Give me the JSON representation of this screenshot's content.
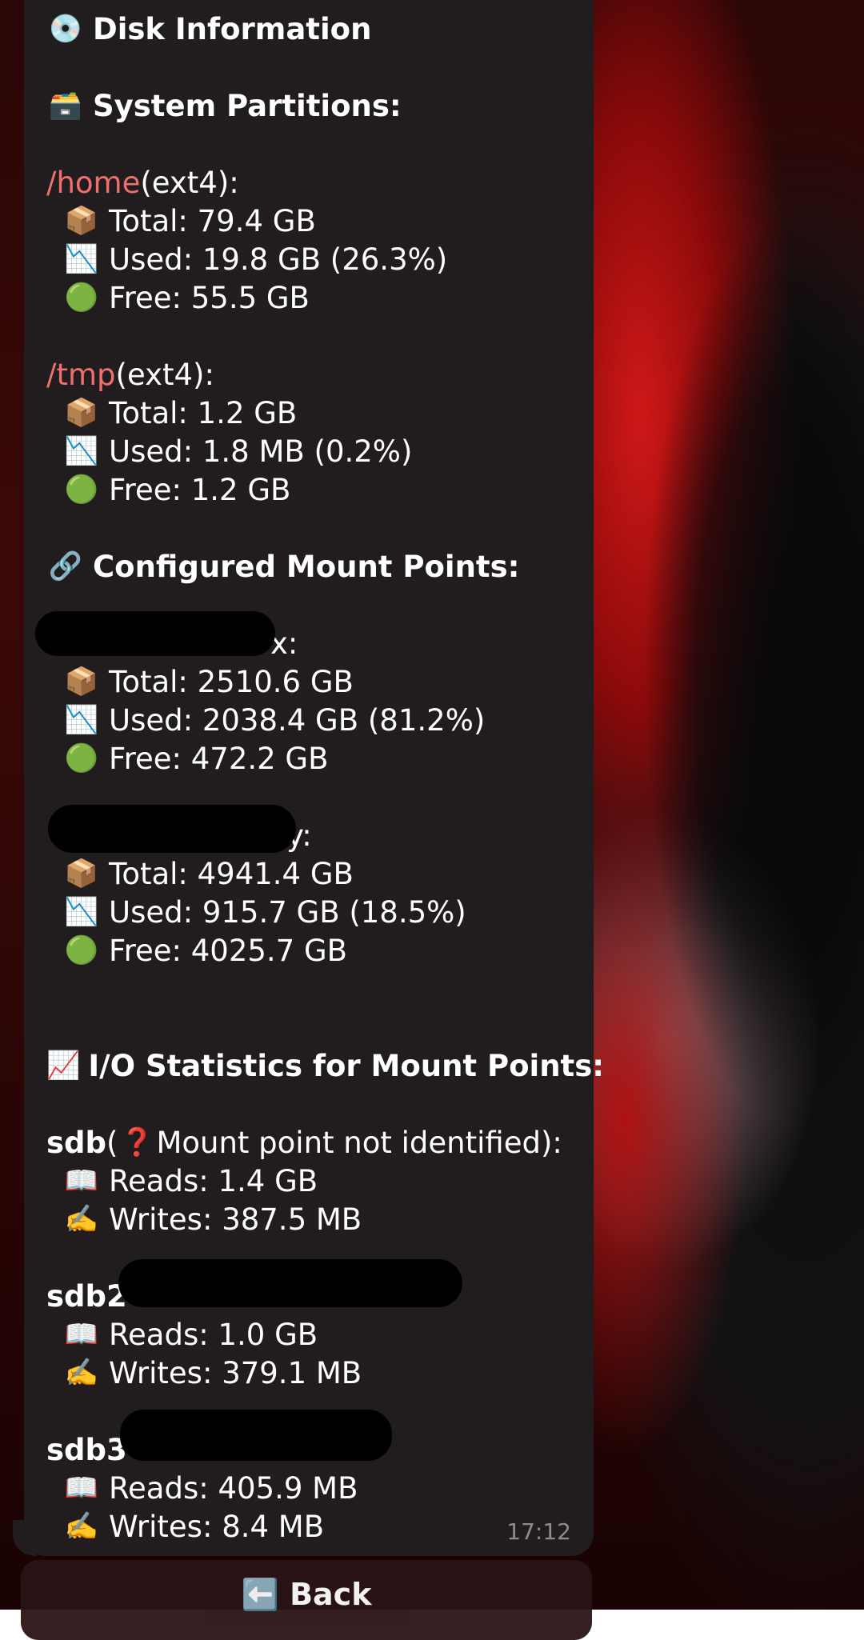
{
  "message": {
    "title": "Disk Information",
    "time": "17:12",
    "partitions_heading": "System Partitions:",
    "partitions": [
      {
        "path": "/home",
        "fs": " (ext4):",
        "total": "Total: 79.4 GB",
        "used": "Used: 19.8 GB (26.3%)",
        "free": "Free: 55.5 GB"
      },
      {
        "path": "/tmp",
        "fs": " (ext4):",
        "total": "Total: 1.2 GB",
        "used": "Used: 1.8 MB (0.2%)",
        "free": "Free: 1.2 GB"
      }
    ],
    "mounts_heading": "Configured Mount Points:",
    "mounts": [
      {
        "name_visible": "x:",
        "total": "Total: 2510.6 GB",
        "used": "Used: 2038.4 GB (81.2%)",
        "free": "Free: 472.2 GB"
      },
      {
        "name_visible": "y:",
        "total": "Total: 4941.4 GB",
        "used": "Used: 915.7 GB (18.5%)",
        "free": "Free: 4025.7 GB"
      }
    ],
    "io_heading": "I/O Statistics for Mount Points:",
    "io": [
      {
        "device": "sdb",
        "note_open": " (",
        "note": " Mount point not identified):",
        "reads": "Reads: 1.4 GB",
        "writes": "Writes: 387.5 MB"
      },
      {
        "device": "sdb2",
        "reads": "Reads: 1.0 GB",
        "writes": "Writes: 379.1 MB"
      },
      {
        "device": "sdb3",
        "reads": "Reads: 405.9 MB",
        "writes": "Writes: 8.4 MB"
      }
    ]
  },
  "keyboard": {
    "back_label": "Back"
  },
  "icons": {
    "disk": "disk-icon",
    "card_index": "card-index-box-icon",
    "package": "package-icon",
    "chart_down": "chart-decreasing-icon",
    "green_circle": "green-circle-icon",
    "link": "link-icon",
    "chart_up": "chart-increasing-icon",
    "question": "question-mark-icon",
    "book": "open-book-icon",
    "writing": "writing-hand-icon",
    "back_arrow": "back-arrow-icon"
  }
}
